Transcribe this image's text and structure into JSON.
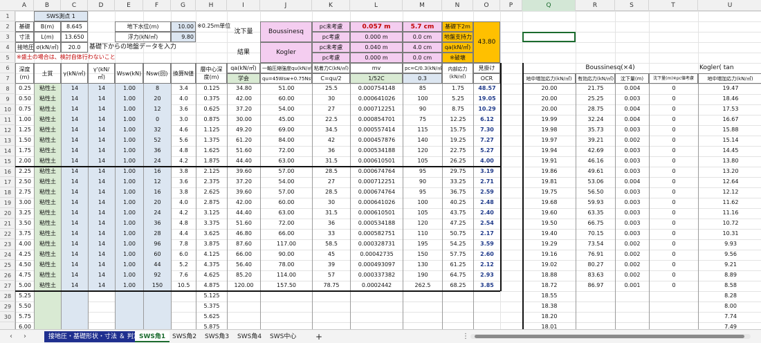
{
  "colors": {
    "accent_green": "#1b6b2e",
    "header_blue": "#dce6f1",
    "soil_green": "#d9ead3",
    "pink": "#f4cdf0",
    "orange": "#ffc000",
    "red": "#c00000",
    "navy": "#1f3a8a"
  },
  "columns": [
    "A",
    "B",
    "C",
    "D",
    "E",
    "F",
    "G",
    "H",
    "I",
    "J",
    "K",
    "L",
    "M",
    "N",
    "O",
    "P",
    "Q",
    "R",
    "S",
    "T",
    "U"
  ],
  "title": "SWS測点 1",
  "header": {
    "r2": {
      "a": "基礎",
      "b": "B(m)",
      "c": "8.645"
    },
    "r3": {
      "a": "寸法",
      "b": "L(m)",
      "c": "13.650"
    },
    "r4": {
      "a": "接地圧",
      "b": "σ(kN/㎡)",
      "c": "20.0",
      "msg": "基礎下からの地盤データを入力"
    },
    "water": {
      "label": "地下水位(m)",
      "value": "10.00",
      "note": "※0.25m単位"
    },
    "buoy": {
      "label": "浮力(kN/㎡)",
      "value": "9.80"
    },
    "warn": "※盛土の場合は、検討自体行わないこと",
    "settle_label1": "沈下量",
    "settle_label2": "結果",
    "bous": "Boussinesq",
    "kogler": "Kogler",
    "pc1": "pc未考慮",
    "pc2": "pc考慮",
    "pc3": "pc未考慮",
    "pc4": "pc考慮",
    "l2": "0.057 m",
    "m2": "5.7 cm",
    "l3": "0.000 m",
    "m3": "0.0 cm",
    "l4": "0.040 m",
    "m4": "4.0 cm",
    "l5": "0.000 m",
    "m5": "0.0 cm",
    "n2": "基礎下2m",
    "n3": "地盤支持力",
    "n4": "qa(kN/㎡)",
    "n5": "※破壊",
    "o3": "43.80"
  },
  "colheads": {
    "a": "深度(m)",
    "b": "土質",
    "c": "γ(kN/㎥)",
    "d": "γ'(kN/㎥)",
    "e": "Wsw(kN)",
    "f": "Nsw(回)",
    "g": "換算N値",
    "h": "層中心深度(m)",
    "i": "qa(kN/㎡)",
    "i2": "学会",
    "j": "一軸圧縮強度qu(kN/㎡)",
    "j2": "qu=45Wsw+0.75Nsw",
    "k": "粘着力C(kN/㎡)",
    "k2": "C=qu/2",
    "l": "mv",
    "l2": "1/52C",
    "m": "pc=C/0.3(kN/㎡)",
    "m2": "0.3",
    "n": "内部応力(kN/㎡)",
    "o": "見掛け",
    "o2": "OCR",
    "bous_h": "Boussinesq(×4)",
    "kog_h": "Kogler( tan",
    "q": "地中増加応力(kN/㎡)",
    "r": "有効応力(kN/㎡)",
    "s": "沈下量(m)",
    "t": "沈下量(m)※pc値考慮",
    "u": "地中増加応力(kN/㎡)"
  },
  "rows": [
    [
      "0.25",
      "粘性土",
      "14",
      "14",
      "1.00",
      "8",
      "3.4",
      "0.125",
      "34.80",
      "51.00",
      "25.5",
      "0.000754148",
      "85",
      "1.75",
      "48.57",
      "20.00",
      "21.75",
      "0.004",
      "0",
      "19.47"
    ],
    [
      "0.50",
      "粘性土",
      "14",
      "14",
      "1.00",
      "20",
      "4.0",
      "0.375",
      "42.00",
      "60.00",
      "30",
      "0.000641026",
      "100",
      "5.25",
      "19.05",
      "20.00",
      "25.25",
      "0.003",
      "0",
      "18.46"
    ],
    [
      "0.75",
      "粘性土",
      "14",
      "14",
      "1.00",
      "12",
      "3.6",
      "0.625",
      "37.20",
      "54.00",
      "27",
      "0.000712251",
      "90",
      "8.75",
      "10.29",
      "20.00",
      "28.75",
      "0.004",
      "0",
      "17.53"
    ],
    [
      "1.00",
      "粘性土",
      "14",
      "14",
      "1.00",
      "0",
      "3.0",
      "0.875",
      "30.00",
      "45.00",
      "22.5",
      "0.000854701",
      "75",
      "12.25",
      "6.12",
      "19.99",
      "32.24",
      "0.004",
      "0",
      "16.67"
    ],
    [
      "1.25",
      "粘性土",
      "14",
      "14",
      "1.00",
      "32",
      "4.6",
      "1.125",
      "49.20",
      "69.00",
      "34.5",
      "0.000557414",
      "115",
      "15.75",
      "7.30",
      "19.98",
      "35.73",
      "0.003",
      "0",
      "15.88"
    ],
    [
      "1.50",
      "粘性土",
      "14",
      "14",
      "1.00",
      "52",
      "5.6",
      "1.375",
      "61.20",
      "84.00",
      "42",
      "0.000457876",
      "140",
      "19.25",
      "7.27",
      "19.97",
      "39.21",
      "0.002",
      "0",
      "15.14"
    ],
    [
      "1.75",
      "粘性土",
      "14",
      "14",
      "1.00",
      "36",
      "4.8",
      "1.625",
      "51.60",
      "72.00",
      "36",
      "0.000534188",
      "120",
      "22.75",
      "5.27",
      "19.94",
      "42.69",
      "0.003",
      "0",
      "14.45"
    ],
    [
      "2.00",
      "粘性土",
      "14",
      "14",
      "1.00",
      "24",
      "4.2",
      "1.875",
      "44.40",
      "63.00",
      "31.5",
      "0.000610501",
      "105",
      "26.25",
      "4.00",
      "19.91",
      "46.16",
      "0.003",
      "0",
      "13.80"
    ],
    [
      "2.25",
      "粘性土",
      "14",
      "14",
      "1.00",
      "16",
      "3.8",
      "2.125",
      "39.60",
      "57.00",
      "28.5",
      "0.000674764",
      "95",
      "29.75",
      "3.19",
      "19.86",
      "49.61",
      "0.003",
      "0",
      "13.20"
    ],
    [
      "2.50",
      "粘性土",
      "14",
      "14",
      "1.00",
      "12",
      "3.6",
      "2.375",
      "37.20",
      "54.00",
      "27",
      "0.000712251",
      "90",
      "33.25",
      "2.71",
      "19.81",
      "53.06",
      "0.004",
      "0",
      "12.64"
    ],
    [
      "2.75",
      "粘性土",
      "14",
      "14",
      "1.00",
      "16",
      "3.8",
      "2.625",
      "39.60",
      "57.00",
      "28.5",
      "0.000674764",
      "95",
      "36.75",
      "2.59",
      "19.75",
      "56.50",
      "0.003",
      "0",
      "12.12"
    ],
    [
      "3.00",
      "粘性土",
      "14",
      "14",
      "1.00",
      "20",
      "4.0",
      "2.875",
      "42.00",
      "60.00",
      "30",
      "0.000641026",
      "100",
      "40.25",
      "2.48",
      "19.68",
      "59.93",
      "0.003",
      "0",
      "11.62"
    ],
    [
      "3.25",
      "粘性土",
      "14",
      "14",
      "1.00",
      "24",
      "4.2",
      "3.125",
      "44.40",
      "63.00",
      "31.5",
      "0.000610501",
      "105",
      "43.75",
      "2.40",
      "19.60",
      "63.35",
      "0.003",
      "0",
      "11.16"
    ],
    [
      "3.50",
      "粘性土",
      "14",
      "14",
      "1.00",
      "36",
      "4.8",
      "3.375",
      "51.60",
      "72.00",
      "36",
      "0.000534188",
      "120",
      "47.25",
      "2.54",
      "19.50",
      "66.75",
      "0.003",
      "0",
      "10.72"
    ],
    [
      "3.75",
      "粘性土",
      "14",
      "14",
      "1.00",
      "28",
      "4.4",
      "3.625",
      "46.80",
      "66.00",
      "33",
      "0.000582751",
      "110",
      "50.75",
      "2.17",
      "19.40",
      "70.15",
      "0.003",
      "0",
      "10.31"
    ],
    [
      "4.00",
      "粘性土",
      "14",
      "14",
      "1.00",
      "96",
      "7.8",
      "3.875",
      "87.60",
      "117.00",
      "58.5",
      "0.000328731",
      "195",
      "54.25",
      "3.59",
      "19.29",
      "73.54",
      "0.002",
      "0",
      "9.93"
    ],
    [
      "4.25",
      "粘性土",
      "14",
      "14",
      "1.00",
      "60",
      "6.0",
      "4.125",
      "66.00",
      "90.00",
      "45",
      "0.00042735",
      "150",
      "57.75",
      "2.60",
      "19.16",
      "76.91",
      "0.002",
      "0",
      "9.56"
    ],
    [
      "4.50",
      "粘性土",
      "14",
      "14",
      "1.00",
      "44",
      "5.2",
      "4.375",
      "56.40",
      "78.00",
      "39",
      "0.000493097",
      "130",
      "61.25",
      "2.12",
      "19.02",
      "80.27",
      "0.002",
      "0",
      "9.21"
    ],
    [
      "4.75",
      "粘性土",
      "14",
      "14",
      "1.00",
      "92",
      "7.6",
      "4.625",
      "85.20",
      "114.00",
      "57",
      "0.000337382",
      "190",
      "64.75",
      "2.93",
      "18.88",
      "83.63",
      "0.002",
      "0",
      "8.89"
    ],
    [
      "5.00",
      "粘性土",
      "14",
      "14",
      "1.00",
      "150",
      "10.5",
      "4.875",
      "120.00",
      "157.50",
      "78.75",
      "0.0002442",
      "262.5",
      "68.25",
      "3.85",
      "18.72",
      "86.97",
      "0.001",
      "0",
      "8.58"
    ],
    [
      "5.25",
      "",
      "",
      "",
      "",
      "",
      "",
      "5.125",
      "",
      "",
      "",
      "",
      "",
      "",
      "",
      "18.55",
      "",
      "",
      "",
      "8.28"
    ],
    [
      "5.50",
      "",
      "",
      "",
      "",
      "",
      "",
      "5.375",
      "",
      "",
      "",
      "",
      "",
      "",
      "",
      "18.38",
      "",
      "",
      "",
      "8.00"
    ],
    [
      "5.75",
      "",
      "",
      "",
      "",
      "",
      "",
      "5.625",
      "",
      "",
      "",
      "",
      "",
      "",
      "",
      "18.20",
      "",
      "",
      "",
      "7.74"
    ],
    [
      "6.00",
      "",
      "",
      "",
      "",
      "",
      "",
      "5.875",
      "",
      "",
      "",
      "",
      "",
      "",
      "",
      "18.01",
      "",
      "",
      "",
      "7.49"
    ]
  ],
  "tabs": [
    "接地圧・基礎形状・寸法 ＆ 判定",
    "SWS角1",
    "SWS角2",
    "SWS角3",
    "SWS角4",
    "SWS中心"
  ],
  "add_tab": "+",
  "nav_prev": "‹",
  "nav_next": "›",
  "nav_more": "⋮"
}
